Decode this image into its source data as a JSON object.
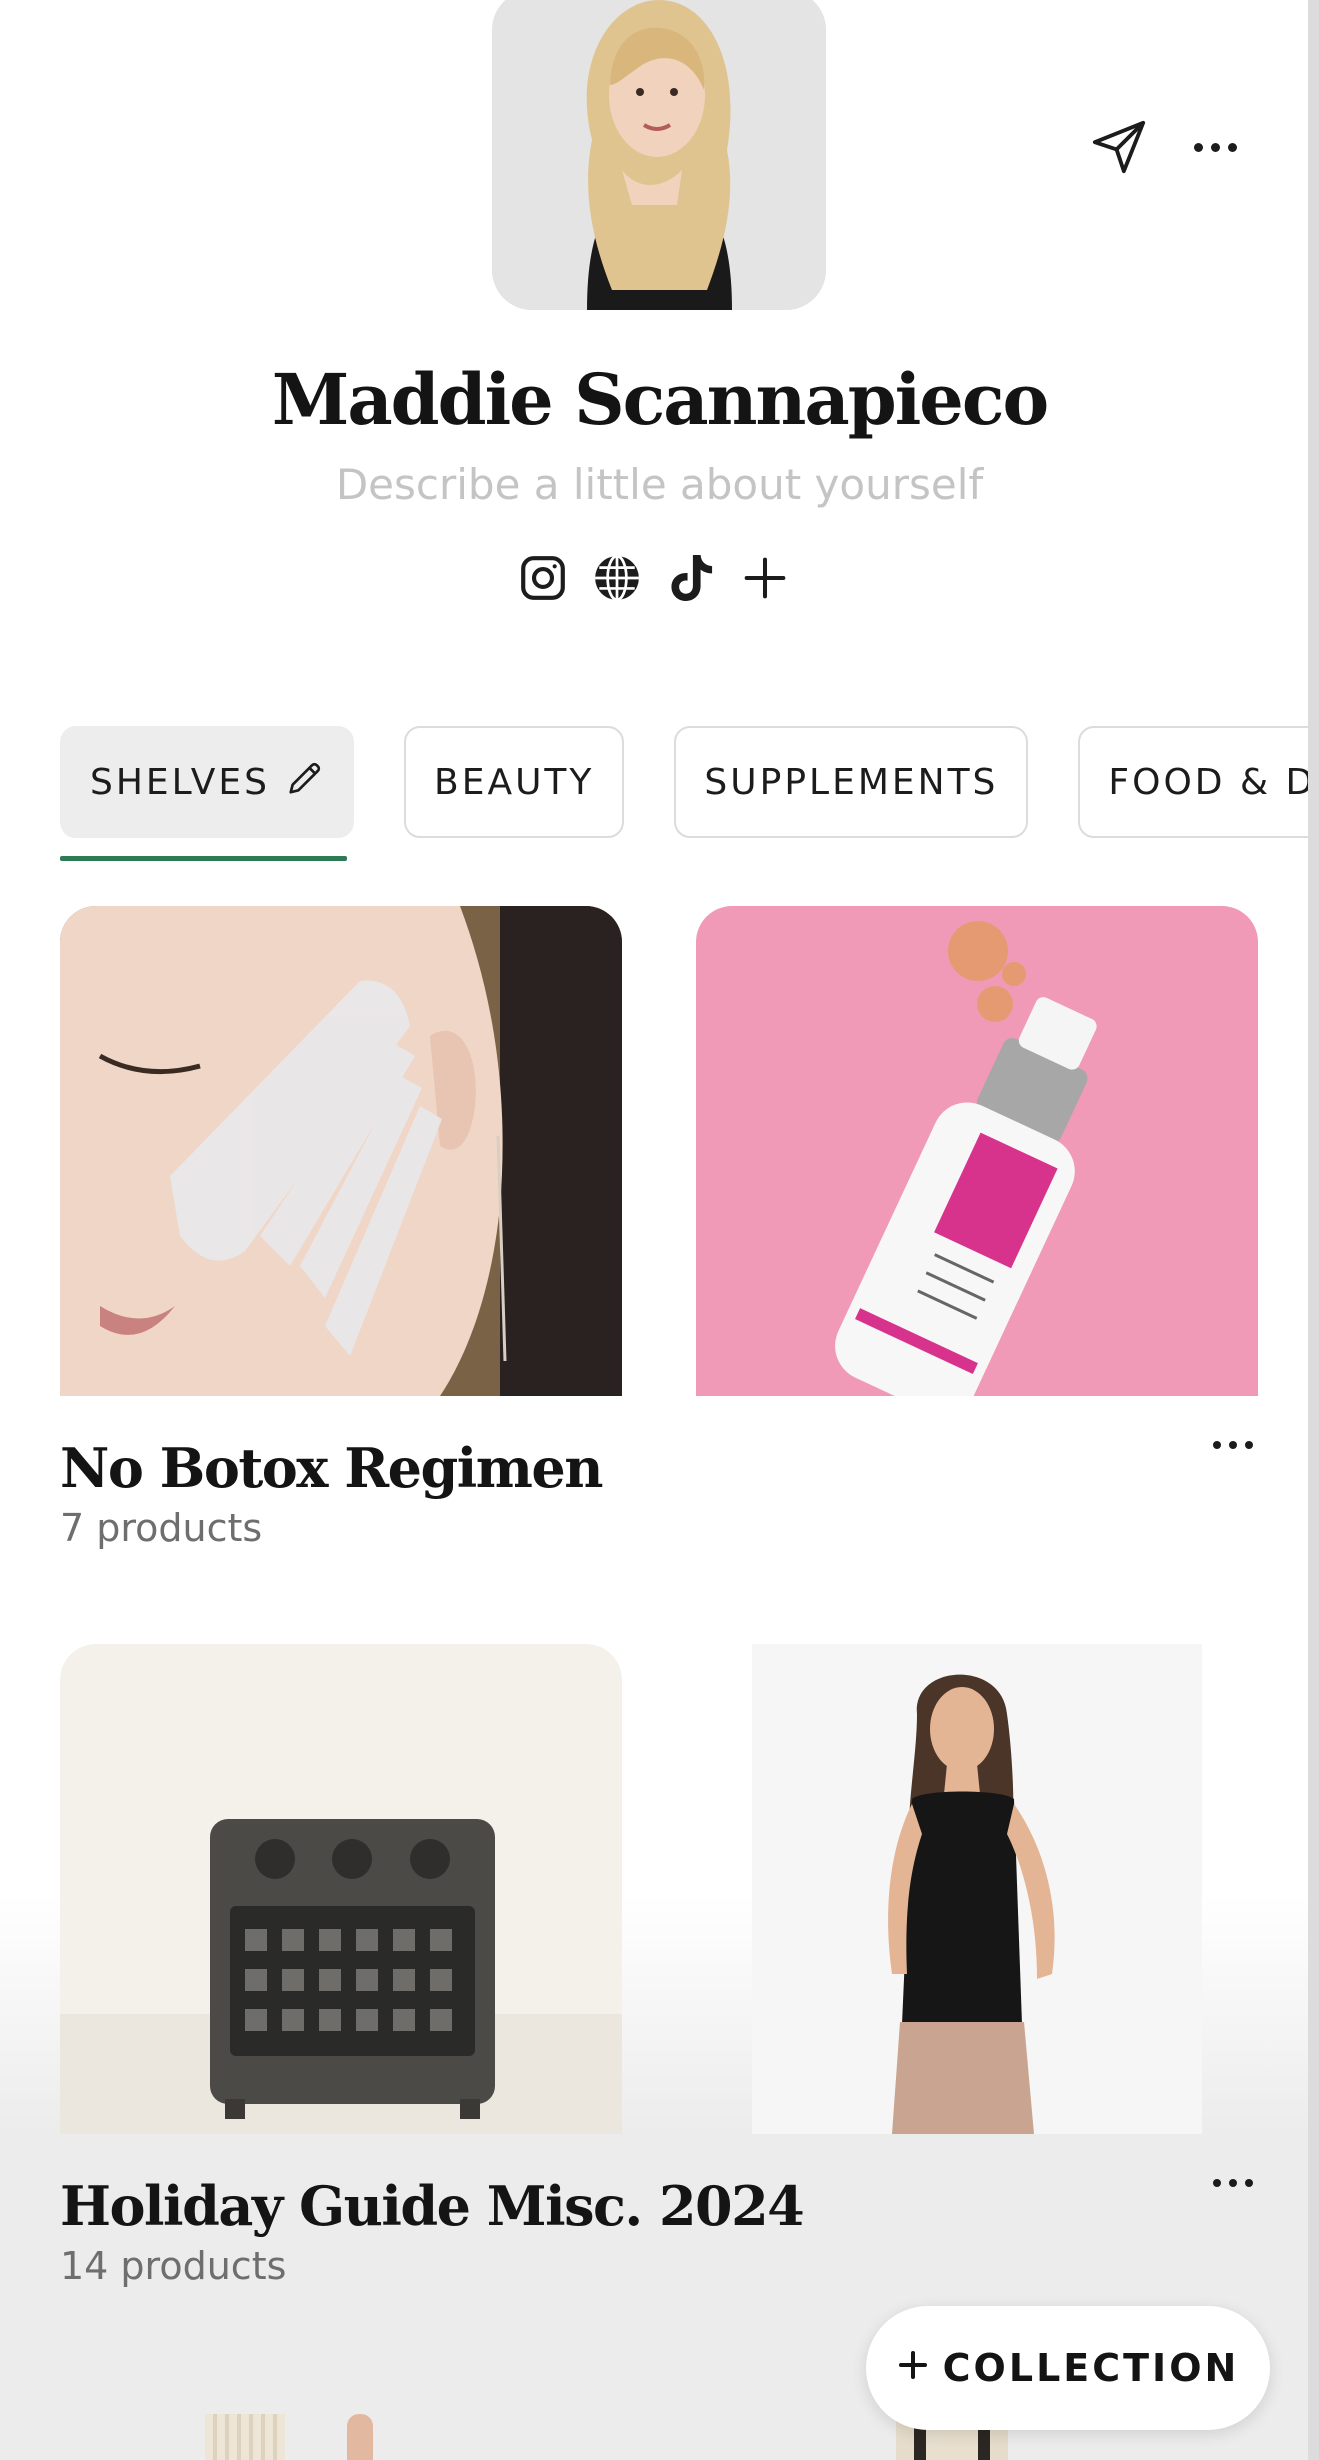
{
  "profile": {
    "name": "Maddie Scannapieco",
    "bio_placeholder": "Describe a little about yourself",
    "social_icons": [
      "instagram-icon",
      "globe-icon",
      "tiktok-icon",
      "plus-icon"
    ]
  },
  "header": {
    "icons": [
      "send-icon",
      "more-icon"
    ]
  },
  "tabs": [
    {
      "label": "SHELVES",
      "active": true,
      "icon": "pencil-icon"
    },
    {
      "label": "BEAUTY",
      "active": false
    },
    {
      "label": "SUPPLEMENTS",
      "active": false
    },
    {
      "label": "FOOD & DR",
      "active": false
    }
  ],
  "collections": [
    {
      "title": "No Botox Regimen",
      "count": "7 products"
    },
    {
      "title": "Holiday Guide Misc. 2024",
      "count": "14 products"
    }
  ],
  "fab": {
    "label": "COLLECTION",
    "icon": "plus-icon"
  },
  "colors": {
    "accent": "#2e7a57",
    "placeholder": "#c4c4c4",
    "tab_active_bg": "#ededed"
  }
}
